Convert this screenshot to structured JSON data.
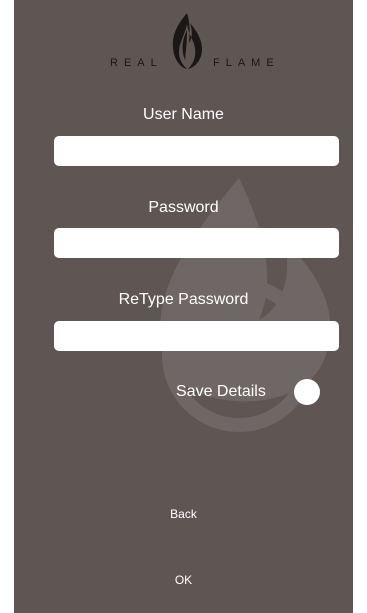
{
  "logo": {
    "left_word": "REAL",
    "right_word": "FLAME"
  },
  "form": {
    "username_label": "User Name",
    "username_value": "",
    "password_label": "Password",
    "password_value": "",
    "retype_label": "ReType Password",
    "retype_value": ""
  },
  "save_details": {
    "label": "Save Details",
    "checked": false
  },
  "buttons": {
    "back": "Back",
    "ok": "OK"
  },
  "colors": {
    "background": "#5f5654",
    "text": "#ffffff",
    "logo": "#1b1717"
  },
  "icons": {
    "logo_flame": "flame-logo-icon",
    "watermark": "flame-watermark-icon"
  }
}
